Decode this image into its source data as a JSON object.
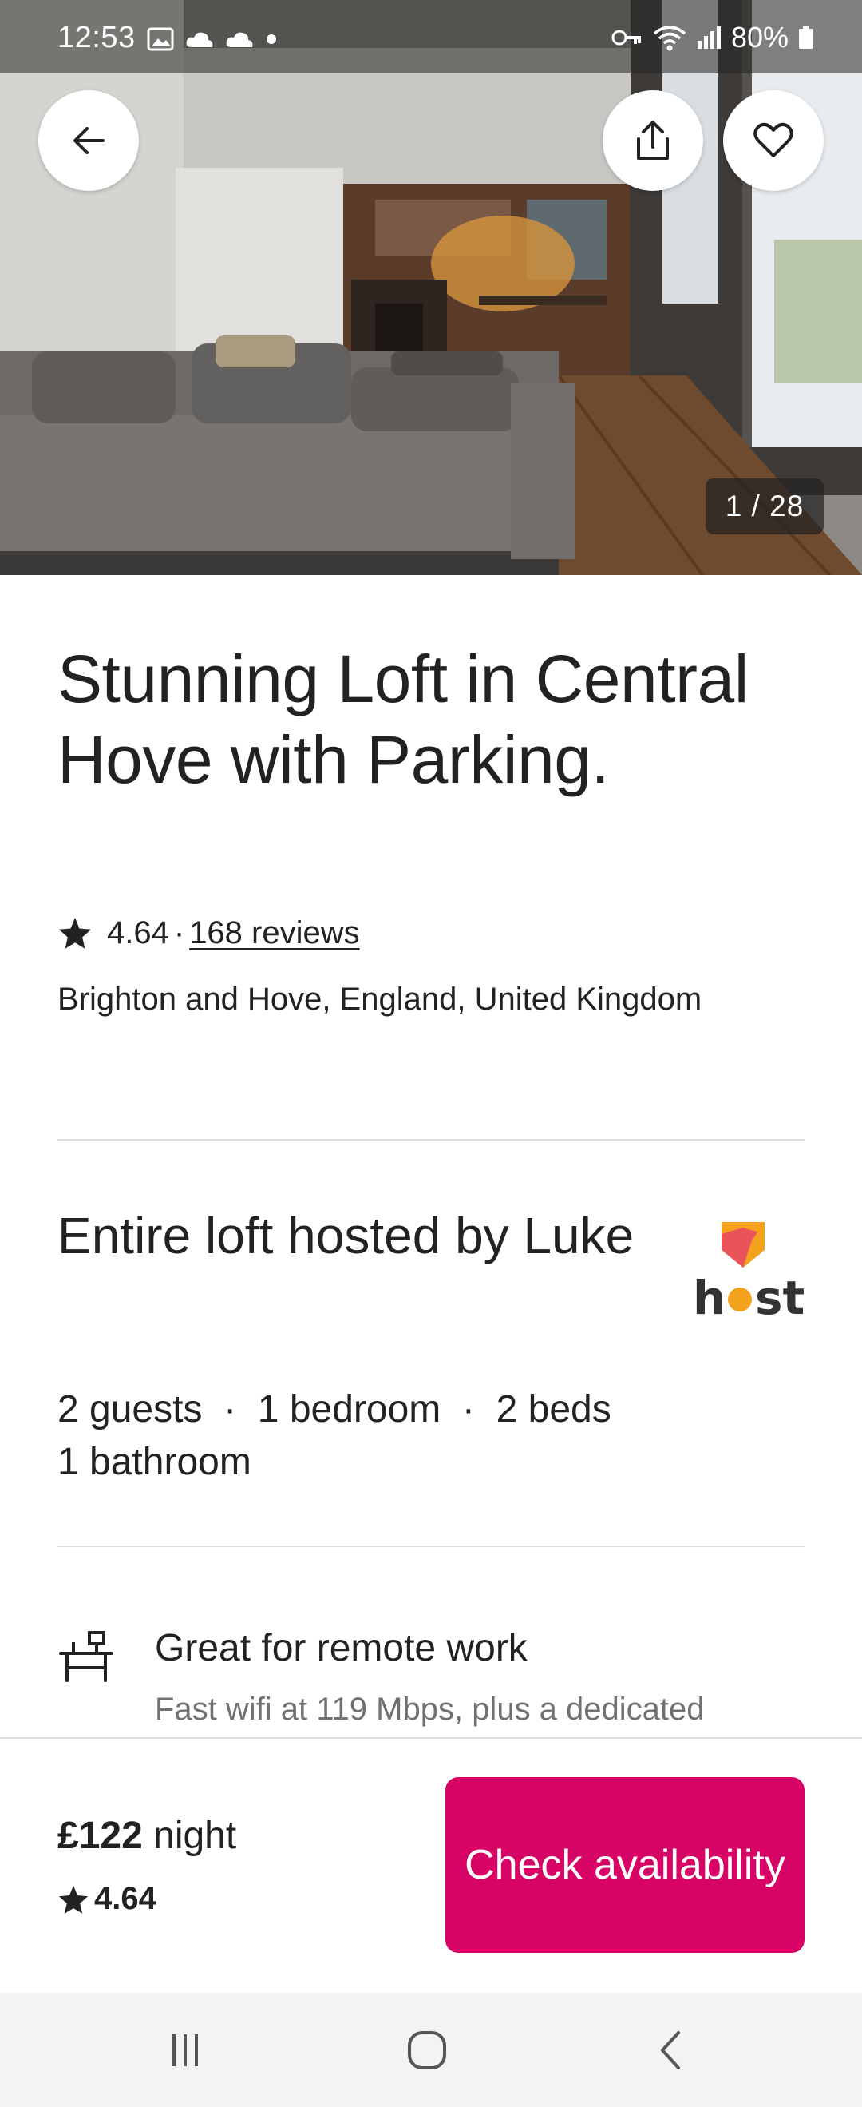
{
  "status_bar": {
    "time": "12:53",
    "battery": "80%",
    "icons": [
      "image-icon",
      "cloud-icon",
      "cloud-icon",
      "dot-icon",
      "key-icon",
      "wifi-icon",
      "signal-icon",
      "battery-icon"
    ]
  },
  "photo": {
    "counter": "1 / 28"
  },
  "listing": {
    "title": "Stunning Loft in Central Hove with Parking.",
    "rating": "4.64",
    "separator": "·",
    "reviews": "168 reviews",
    "location": "Brighton and Hove, England, United Kingdom"
  },
  "host": {
    "heading": "Entire loft hosted by Luke",
    "logo_text": "host",
    "logo_colors": {
      "orange": "#f4a21e",
      "red": "#e8545a",
      "dark": "#333333"
    }
  },
  "specs": {
    "line1": "2 guests  ·  1 bedroom  ·  2 beds",
    "line2": "1 bathroom"
  },
  "highlight": {
    "title": "Great for remote work",
    "subtitle": "Fast wifi at 119 Mbps, plus a dedicated"
  },
  "booking": {
    "price": "£122",
    "unit": "night",
    "rating": "4.64",
    "button": "Check availability",
    "button_color": "#d70466"
  }
}
